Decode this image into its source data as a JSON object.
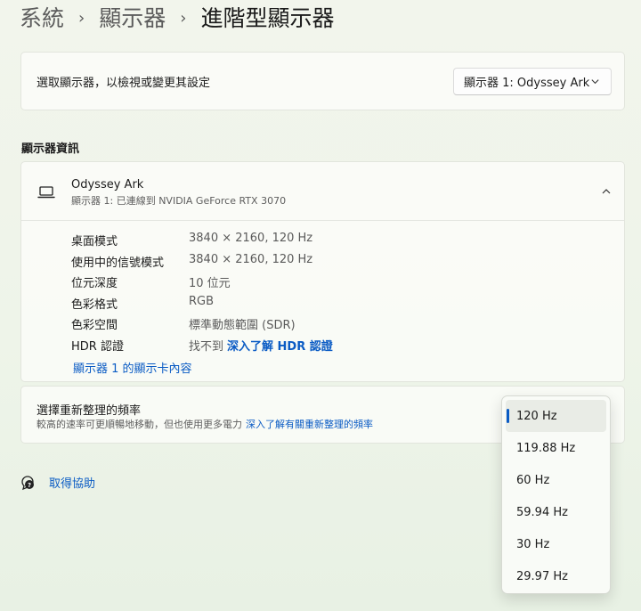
{
  "breadcrumb": {
    "items": [
      "系統",
      "顯示器"
    ],
    "separator": "›",
    "current": "進階型顯示器"
  },
  "display_select": {
    "label": "選取顯示器，以檢視或變更其設定",
    "selected": "顯示器 1: Odyssey Ark"
  },
  "display_info": {
    "section_title": "顯示器資訊",
    "monitor_name": "Odyssey Ark",
    "monitor_subtitle": "顯示器 1: 已連線到 NVIDIA GeForce RTX 3070",
    "rows": [
      {
        "label": "桌面模式",
        "value": "3840 × 2160, 120 Hz"
      },
      {
        "label": "使用中的信號模式",
        "value": "3840 × 2160, 120 Hz"
      },
      {
        "label": "位元深度",
        "value": "10 位元"
      },
      {
        "label": "色彩格式",
        "value": "RGB"
      },
      {
        "label": "色彩空間",
        "value": "標準動態範圍 (SDR)"
      },
      {
        "label": "HDR 認證",
        "value": "找不到",
        "link": "深入了解 HDR 認證"
      }
    ],
    "adapter_link": "顯示器 1 的顯示卡內容"
  },
  "refresh_rate": {
    "title": "選擇重新整理的頻率",
    "description": "較高的速率可更順暢地移動，但也使用更多電力",
    "link": "深入了解有關重新整理的頻率",
    "options": [
      "120 Hz",
      "119.88 Hz",
      "60 Hz",
      "59.94 Hz",
      "30 Hz",
      "29.97 Hz"
    ],
    "selected": "120 Hz"
  },
  "help": {
    "label": "取得協助"
  },
  "colors": {
    "accent": "#0a5bc4",
    "background": "#eef4e9"
  }
}
